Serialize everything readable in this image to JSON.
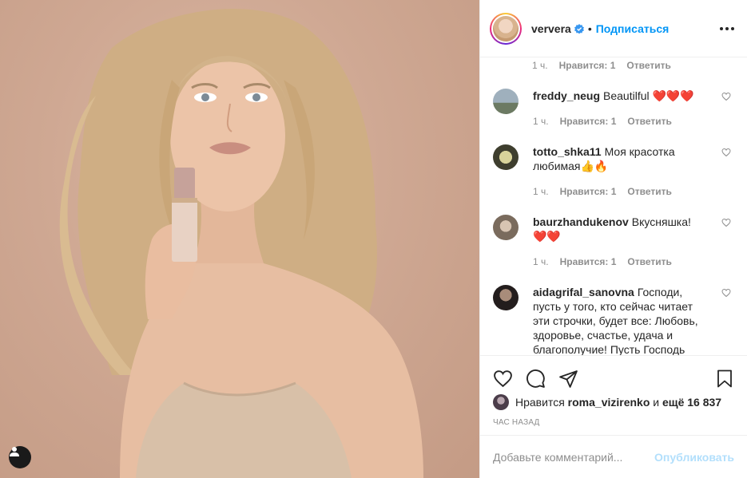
{
  "post": {
    "username": "ververa",
    "follow_label": "Подписаться",
    "separator": "•"
  },
  "comments": {
    "first_meta": {
      "time": "1 ч.",
      "likes": "Нравится: 1",
      "reply": "Ответить"
    },
    "items": [
      {
        "user": "freddy_neug",
        "text": "Beautilful",
        "emoji": "❤️❤️❤️",
        "time": "1 ч.",
        "likes": "Нравится: 1",
        "reply": "Ответить"
      },
      {
        "user": "totto_shka11",
        "text": "Моя красотка любимая",
        "emoji": "👍🔥",
        "time": "1 ч.",
        "likes": "Нравится: 1",
        "reply": "Ответить"
      },
      {
        "user": "baurzhandukenov",
        "text": "Вкусняшка!",
        "emoji": "❤️❤️",
        "time": "1 ч.",
        "likes": "Нравится: 1",
        "reply": "Ответить"
      },
      {
        "user": "aidagrifal_sanovna",
        "text": "Господи, пусть у того, кто сейчас читает эти строчки, будет все: Любовь, здоровье, счастье, удача и благополучие! Пусть Господь",
        "emoji": ""
      }
    ]
  },
  "likes": {
    "prefix": "Нравится",
    "user": "roma_vizirenko",
    "middle": "и",
    "count": "ещё 16 837"
  },
  "timestamp": "ЧАС НАЗАД",
  "comment_box": {
    "placeholder": "Добавьте комментарий...",
    "post_label": "Опубликовать"
  },
  "colors": {
    "accent": "#0095f6",
    "post_disabled": "#b2dffc",
    "muted": "#8e8e8e",
    "heart": "#e0245e",
    "photo_bg": "#cfa893"
  },
  "icons": [
    "verified-icon",
    "more-icon",
    "heart-icon",
    "comment-icon",
    "share-icon",
    "bookmark-icon",
    "tag-user-icon"
  ]
}
